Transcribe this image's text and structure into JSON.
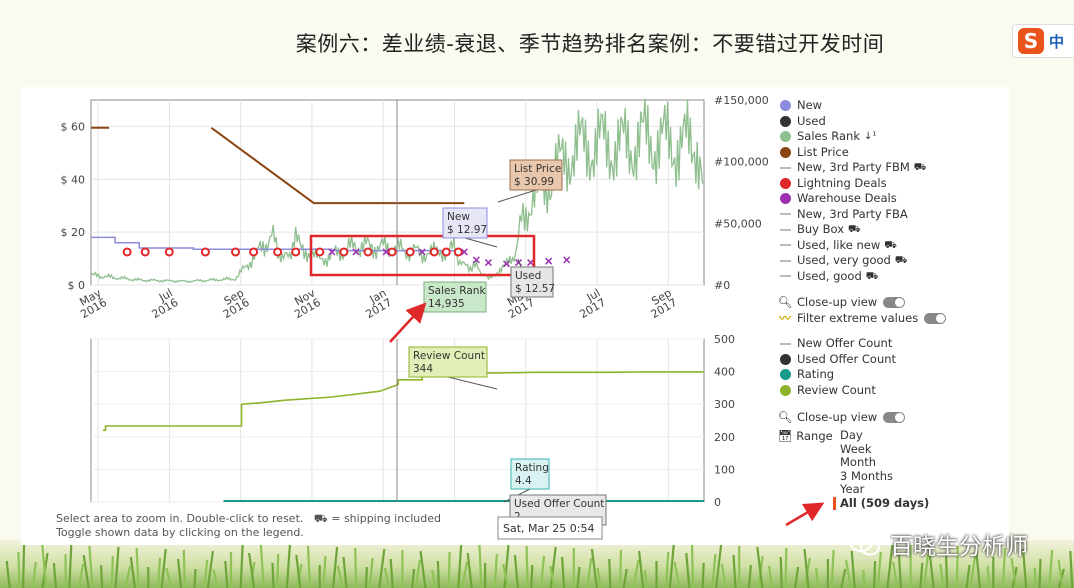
{
  "page": {
    "title": "案例六：差业绩-衰退、季节趋势排名案例：不要错过开发时间",
    "watermark": "百晓生分析师",
    "logo_letter": "S",
    "logo_text": "中"
  },
  "colors": {
    "new": "#8c8cdc",
    "used": "#333333",
    "sales_rank": "#8fbf8f",
    "list_price": "#8b4513",
    "lightning": "#e0282b",
    "warehouse": "#9b30b0",
    "rating": "#169a8a",
    "review": "#8db32b",
    "highlight_box": "#e0282b"
  },
  "chart_data": [
    {
      "type": "line",
      "x_tick_labels": [
        "May 2016",
        "Jul 2016",
        "Sep 2016",
        "Nov 2016",
        "Jan 2017",
        "Mar",
        "May 2017",
        "Jul 2017",
        "Sep 2017"
      ],
      "y_left_ticks": [
        "$ 60",
        "$ 40",
        "$ 20",
        "$ 0"
      ],
      "y_left_range": [
        0,
        70
      ],
      "y_right_ticks": [
        "#150,000",
        "#100,000",
        "#50,000",
        "#0"
      ],
      "y_right_range": [
        0,
        150000
      ],
      "x_range_days": [
        0,
        509
      ],
      "series": [
        {
          "name": "List Price",
          "x": [
            0,
            15,
            15,
            100,
            100,
            185,
            185,
            310
          ],
          "y": [
            59.5,
            59.5,
            null,
            59.5,
            59.5,
            30.99,
            30.99,
            30.99
          ]
        },
        {
          "name": "New",
          "x": [
            0,
            20,
            20,
            40,
            40,
            85,
            85,
            140,
            140,
            200,
            200,
            300,
            300,
            310
          ],
          "y": [
            18,
            18,
            16,
            16,
            14,
            14,
            13.5,
            13.5,
            13.5,
            13.5,
            13.0,
            13.0,
            12.97,
            12.97
          ]
        },
        {
          "name": "Sales Rank",
          "x": [
            0,
            40,
            80,
            120,
            150,
            160,
            170,
            190,
            220,
            250,
            280,
            300,
            310,
            320,
            330,
            350,
            360,
            380,
            400,
            420,
            440,
            460,
            480,
            500,
            509
          ],
          "y": [
            8000,
            4000,
            3000,
            5000,
            40000,
            20000,
            35000,
            20000,
            32000,
            30000,
            25000,
            30000,
            15000,
            15000,
            5000,
            20000,
            60000,
            85000,
            110000,
            115000,
            112000,
            118000,
            115000,
            113000,
            112000
          ]
        }
      ],
      "lightning_deals_x": [
        30,
        45,
        65,
        95,
        120,
        135,
        155,
        170,
        190,
        210,
        230,
        250,
        265,
        285,
        295,
        305
      ],
      "lightning_deals_y": 12.5,
      "warehouse_deals_x": [
        200,
        220,
        245,
        275,
        310,
        320,
        330,
        345,
        355,
        365,
        380,
        395
      ],
      "warehouse_deals_y": [
        12.5,
        12.5,
        12.5,
        12.5,
        12.5,
        9.5,
        8.5,
        8,
        8.5,
        8.5,
        9,
        9.5
      ],
      "tooltips": [
        {
          "label": "List Price",
          "value": "$ 30.99"
        },
        {
          "label": "New",
          "value": "$ 12.97"
        },
        {
          "label": "Used",
          "value": "$ 12.57"
        },
        {
          "label": "Sales Rank",
          "value": "14,935"
        }
      ]
    },
    {
      "type": "line",
      "y_right_ticks": [
        "500",
        "400",
        "300",
        "200",
        "100",
        "0"
      ],
      "y_range": [
        0,
        500
      ],
      "series": [
        {
          "name": "Review Count",
          "x": [
            10,
            12,
            12,
            125,
            125,
            140,
            160,
            200,
            240,
            255,
            255,
            275,
            275,
            310,
            340,
            370,
            400,
            430,
            460,
            509
          ],
          "y": [
            220,
            220,
            233,
            233,
            300,
            304,
            312,
            322,
            340,
            360,
            375,
            375,
            395,
            395,
            396,
            398,
            398,
            398,
            399,
            399
          ]
        },
        {
          "name": "Rating",
          "x": [
            110,
            509
          ],
          "y": [
            0,
            0
          ]
        }
      ],
      "tooltips": [
        {
          "label": "Review Count",
          "value": "344"
        },
        {
          "label": "Rating",
          "value": "4.4"
        },
        {
          "label": "Used Offer Count",
          "value": "2"
        }
      ],
      "crosshair_date": "Sat, Mar 25 0:54"
    }
  ],
  "legend_top": [
    {
      "name": "New",
      "marker": "dot",
      "color": "#8c8cdc"
    },
    {
      "name": "Used",
      "marker": "dot",
      "color": "#333333"
    },
    {
      "name": "Sales Rank",
      "suffix": "↓¹",
      "marker": "dot",
      "color": "#8fbf8f"
    },
    {
      "name": "List Price",
      "marker": "dot",
      "color": "#8b4513"
    },
    {
      "name": "New, 3rd Party FBM",
      "suffix": "⛟",
      "marker": "dash"
    },
    {
      "name": "Lightning Deals",
      "marker": "dot",
      "color": "#e0282b"
    },
    {
      "name": "Warehouse Deals",
      "marker": "dot",
      "color": "#9b30b0"
    },
    {
      "name": "New, 3rd Party FBA",
      "marker": "dash"
    },
    {
      "name": "Buy Box",
      "suffix": "⛟",
      "marker": "dash"
    },
    {
      "name": "Used, like new",
      "suffix": "⛟",
      "marker": "dash"
    },
    {
      "name": "Used, very good",
      "suffix": "⛟",
      "marker": "dash"
    },
    {
      "name": "Used, good",
      "suffix": "⛟",
      "marker": "dash"
    }
  ],
  "toggles_top": {
    "closeup": "Close-up view",
    "filter": "Filter extreme values"
  },
  "legend_bottom": [
    {
      "name": "New Offer Count",
      "marker": "dash"
    },
    {
      "name": "Used Offer Count",
      "marker": "dot",
      "color": "#333333"
    },
    {
      "name": "Rating",
      "marker": "dot",
      "color": "#169a8a"
    },
    {
      "name": "Review Count",
      "marker": "dot",
      "color": "#8db32b"
    }
  ],
  "toggle_bottom": "Close-up view",
  "range": {
    "label": "Range",
    "options": [
      "Day",
      "Week",
      "Month",
      "3 Months",
      "Year",
      "All (509 days)"
    ],
    "selected_index": 5
  },
  "footer": {
    "line1": "Select area to zoom in. Double-click to reset.",
    "shipping_icon": "⛟",
    "line1b": "= shipping included",
    "line2": "Toggle shown data by clicking on the legend."
  }
}
